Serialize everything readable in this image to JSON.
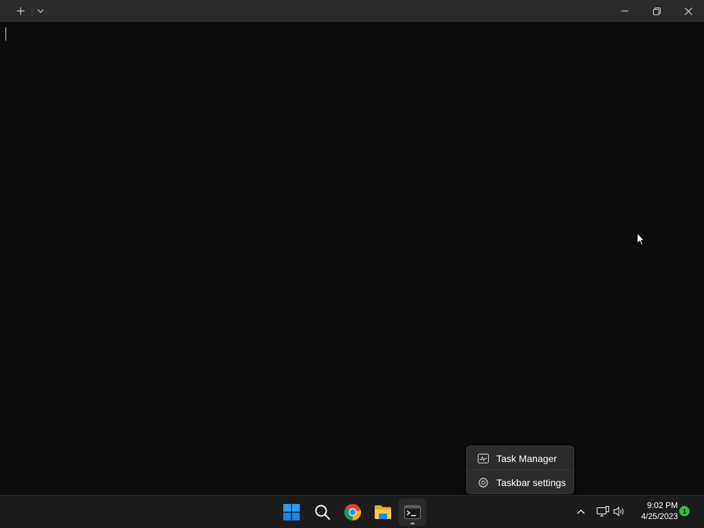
{
  "titlebar": {
    "new_tab_icon": "plus-icon",
    "dropdown_icon": "chevron-down-icon",
    "window_controls": {
      "minimize_icon": "minimize-icon",
      "maximize_icon": "restore-icon",
      "close_icon": "close-icon"
    }
  },
  "terminal": {
    "content": ""
  },
  "context_menu": {
    "items": [
      {
        "label": "Task Manager",
        "icon": "task-manager-icon"
      },
      {
        "label": "Taskbar settings",
        "icon": "gear-icon"
      }
    ]
  },
  "taskbar": {
    "apps": [
      {
        "name": "Start",
        "icon": "windows-start-icon"
      },
      {
        "name": "Search",
        "icon": "search-icon"
      },
      {
        "name": "Google Chrome",
        "icon": "chrome-icon"
      },
      {
        "name": "File Explorer",
        "icon": "folder-icon"
      },
      {
        "name": "Terminal",
        "icon": "terminal-icon",
        "active": true
      }
    ],
    "tray": {
      "chevron_icon": "chevron-up-icon",
      "network_icon": "network-icon",
      "volume_icon": "volume-icon",
      "time": "9:02 PM",
      "date": "4/25/2023",
      "notification_count": "1"
    }
  },
  "colors": {
    "terminal_bg": "#0c0c0c",
    "titlebar_bg": "#2b2b2b",
    "taskbar_bg": "#1c1c1c",
    "menu_bg": "#2c2c2c",
    "badge": "#2fbf3f"
  }
}
